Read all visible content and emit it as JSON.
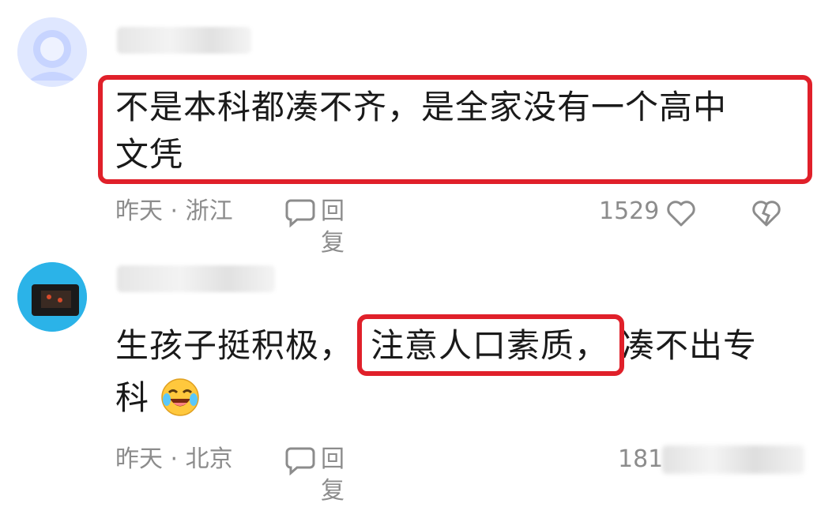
{
  "comments": [
    {
      "text_line1": "不是本科都凑不齐，是全家没有一个高中",
      "text_line2": "文凭",
      "time": "昨天",
      "location": "浙江",
      "reply_label": "回复",
      "like_count": "1529"
    },
    {
      "text_before": "生孩子挺积极，",
      "text_boxed": "注意人口素质，",
      "text_after": "凑不出专",
      "text_line2": "科",
      "emoji": "crying-laughing-emoji",
      "time": "昨天",
      "location": "北京",
      "reply_label": "回复",
      "like_count": "181"
    }
  ],
  "separator": "·",
  "colors": {
    "highlight_box": "#e0202a",
    "meta_text": "#8c8c8c"
  }
}
